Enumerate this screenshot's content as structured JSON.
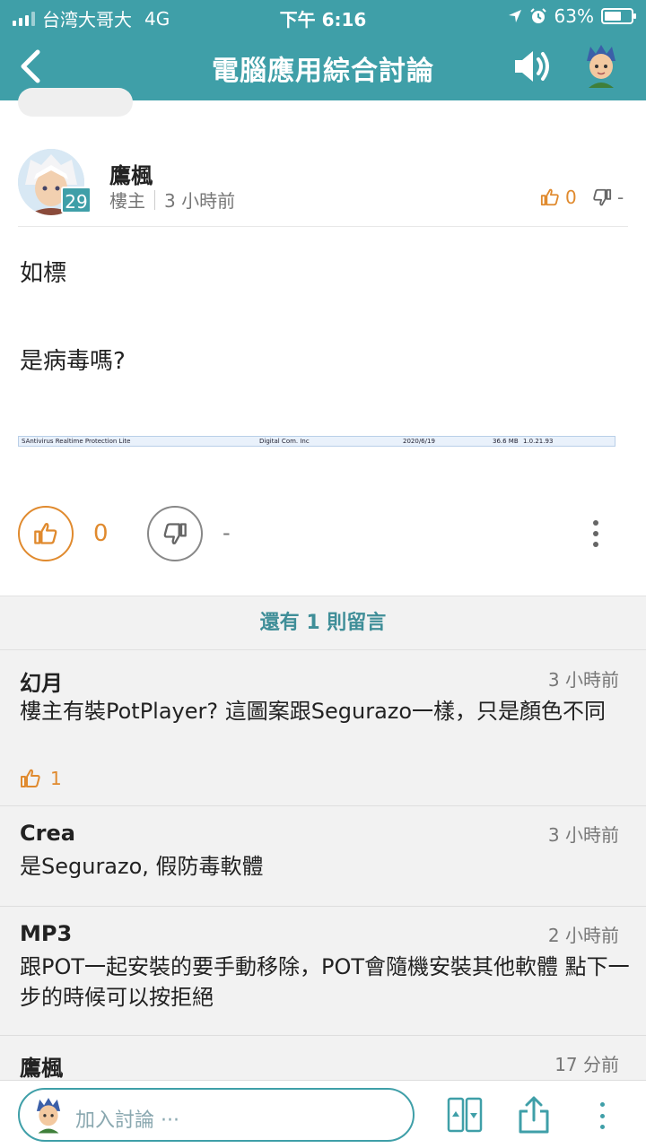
{
  "status_bar": {
    "carrier": "台湾大哥大",
    "network": "4G",
    "time": "下午 6:16",
    "battery": "63%",
    "battery_level": 0.63
  },
  "nav": {
    "title": "電腦應用綜合討論"
  },
  "post": {
    "author": "鷹楓",
    "level": "29",
    "role": "樓主",
    "time": "3 小時前",
    "header_like_count": "0",
    "header_dislike_count": "-",
    "body_line1": "如標",
    "body_line2": "是病毒嗎?",
    "screenshot_row": {
      "name": "SAntivirus Realtime Protection Lite",
      "publisher": "Digital Com. Inc",
      "date": "2020/6/19",
      "size": "36.6 MB",
      "version": "1.0.21.93"
    },
    "like_count": "0",
    "dislike_count": "-"
  },
  "comments": {
    "more_label": "還有 1 則留言",
    "items": [
      {
        "author": "幻月",
        "time": "3 小時前",
        "text": "樓主有裝PotPlayer? 這圖案跟Segurazo一樣，只是顏色不同",
        "likes": "1"
      },
      {
        "author": "Crea",
        "time": "3 小時前",
        "text": "是Segurazo, 假防毒軟體"
      },
      {
        "author": "MP3",
        "time": "2 小時前",
        "text": "跟POT一起安裝的要手動移除，POT會隨機安裝其他軟體 點下一步的時候可以按拒絕"
      },
      {
        "author": "鷹楓",
        "time": "17 分前"
      }
    ]
  },
  "bottom_bar": {
    "placeholder": "加入討論 ···"
  },
  "colors": {
    "brand": "#3f9fa8",
    "like": "#e08a2e"
  }
}
